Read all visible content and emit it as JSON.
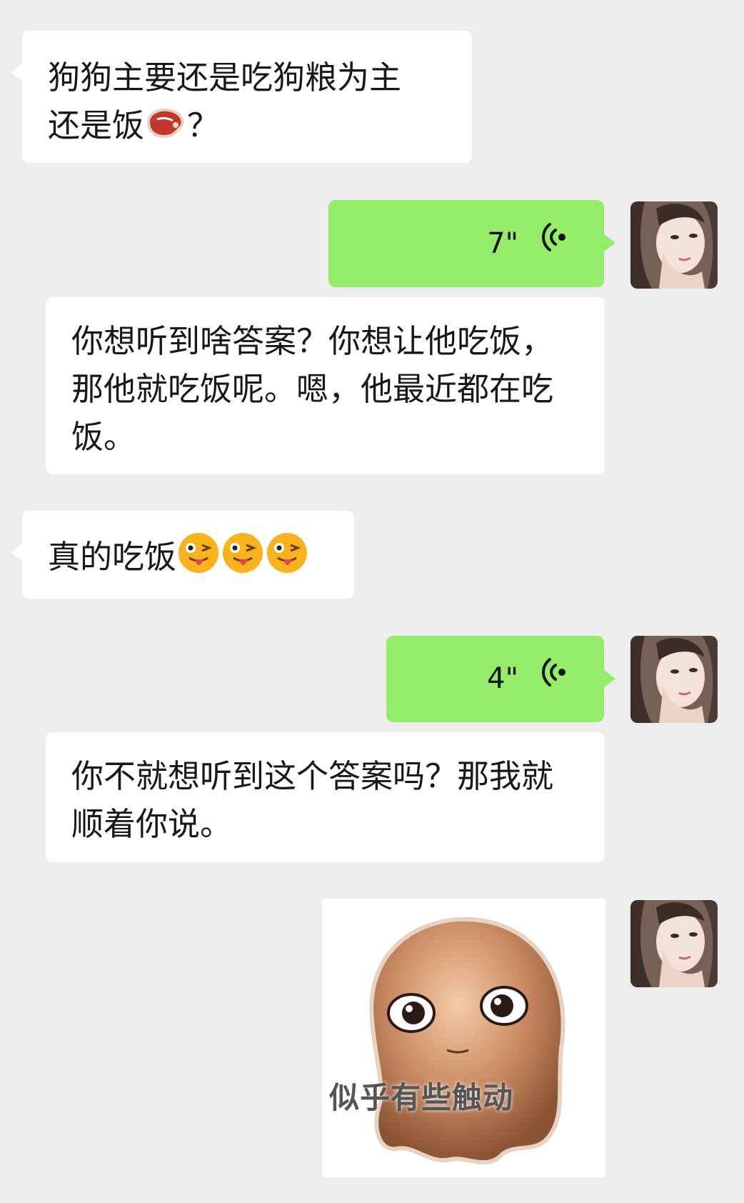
{
  "messages": {
    "m1": {
      "text1": "狗狗主要还是吃狗粮为主",
      "text2": "还是饭",
      "emoji": "steak-emoji",
      "text3": "？"
    },
    "m2": {
      "duration": "7\""
    },
    "m3": {
      "text": "你想听到啥答案？你想让他吃饭，那他就吃饭呢。嗯，他最近都在吃饭。"
    },
    "m4": {
      "text": "真的吃饭",
      "emoji": "winking-tongue-emoji"
    },
    "m5": {
      "duration": "4\""
    },
    "m6": {
      "text": "你不就想听到这个答案吗？那我就顺着你说。"
    },
    "m7": {
      "sticker_caption": "似乎有些触动"
    }
  },
  "colors": {
    "background": "#ededed",
    "incoming_bubble": "#ffffff",
    "outgoing_bubble": "#95ec69"
  }
}
